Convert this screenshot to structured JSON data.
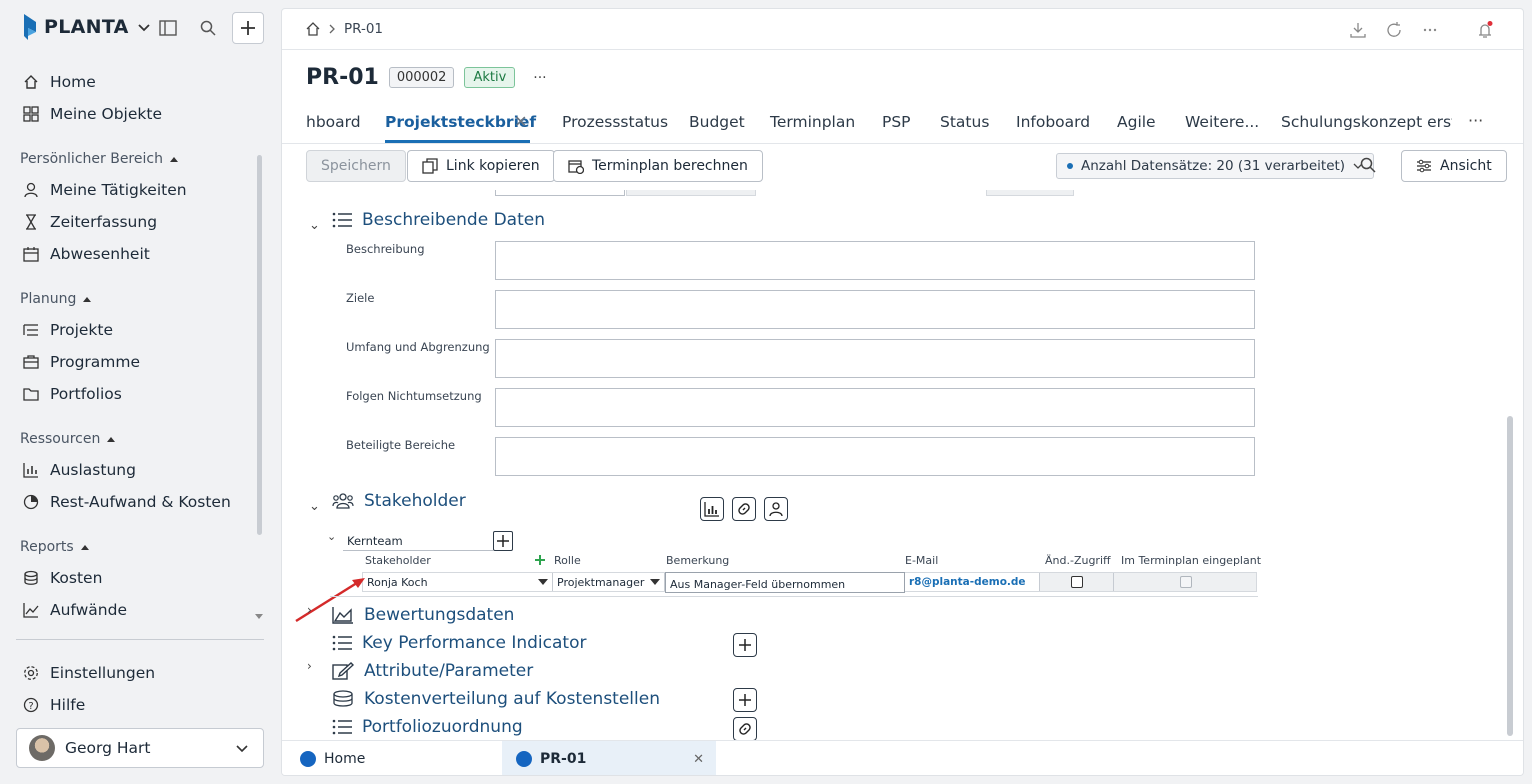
{
  "app": {
    "logo_text": "PLANTA"
  },
  "sidebar": {
    "items_top": [
      {
        "label": "Home",
        "icon": "home-icon"
      },
      {
        "label": "Meine Objekte",
        "icon": "grid-icon"
      }
    ],
    "groups": [
      {
        "title": "Persönlicher Bereich",
        "items": [
          {
            "label": "Meine Tätigkeiten",
            "icon": "user-icon"
          },
          {
            "label": "Zeiterfassung",
            "icon": "hourglass-icon"
          },
          {
            "label": "Abwesenheit",
            "icon": "calendar-icon"
          }
        ]
      },
      {
        "title": "Planung",
        "items": [
          {
            "label": "Projekte",
            "icon": "list-icon"
          },
          {
            "label": "Programme",
            "icon": "briefcase-icon"
          },
          {
            "label": "Portfolios",
            "icon": "folder-icon"
          }
        ]
      },
      {
        "title": "Ressourcen",
        "items": [
          {
            "label": "Auslastung",
            "icon": "bar-chart-icon"
          },
          {
            "label": "Rest-Aufwand & Kosten",
            "icon": "pie-chart-icon"
          }
        ]
      },
      {
        "title": "Reports",
        "items": [
          {
            "label": "Kosten",
            "icon": "coins-icon"
          },
          {
            "label": "Aufwände",
            "icon": "chart-icon"
          }
        ]
      }
    ],
    "settings": "Einstellungen",
    "help": "Hilfe",
    "user": "Georg Hart"
  },
  "breadcrumb": {
    "current": "PR-01"
  },
  "header": {
    "title": "PR-01",
    "number": "000002",
    "status": "Aktiv",
    "more": "···"
  },
  "tabs": [
    "hboard",
    "Projektsteckbrief",
    "Prozessstatus",
    "Budget",
    "Terminplan",
    "PSP",
    "Status",
    "Infoboard",
    "Agile",
    "Weitere...",
    "Schulungskonzept erstel"
  ],
  "tab_more": "···",
  "toolbar": {
    "save": "Speichern",
    "copy_link": "Link kopieren",
    "calc_schedule": "Terminplan berechnen",
    "records": "Anzahl Datensätze: 20 (31 verarbeitet)",
    "view": "Ansicht"
  },
  "sections": {
    "desc": "Beschreibende Daten",
    "stakeholder": "Stakeholder",
    "rating": "Bewertungsdaten",
    "kpi": "Key Performance Indicator",
    "attributes": "Attribute/Parameter",
    "costs": "Kostenverteilung auf Kostenstellen",
    "portfolio": "Portfoliozuordnung"
  },
  "fields": [
    "Beschreibung",
    "Ziele",
    "Umfang und Abgrenzung",
    "Folgen Nichtumsetzung",
    "Beteiligte Bereiche"
  ],
  "stakeholder_table": {
    "group": "Kernteam",
    "headers": {
      "stakeholder": "Stakeholder",
      "role": "Rolle",
      "remark": "Bemerkung",
      "email": "E-Mail",
      "change_access": "Änd.-Zugriff",
      "in_schedule": "Im Terminplan eingeplant"
    },
    "row": {
      "stakeholder": "Ronja Koch",
      "role": "Projektmanager",
      "remark": "Aus Manager-Feld übernommen",
      "email": "r8@planta-demo.de"
    }
  },
  "bottom_tabs": [
    "Home",
    "PR-01"
  ],
  "colors": {
    "accent": "#1a6fb5",
    "arrow": "#d42a2a",
    "status_green": "#1d7a43"
  }
}
